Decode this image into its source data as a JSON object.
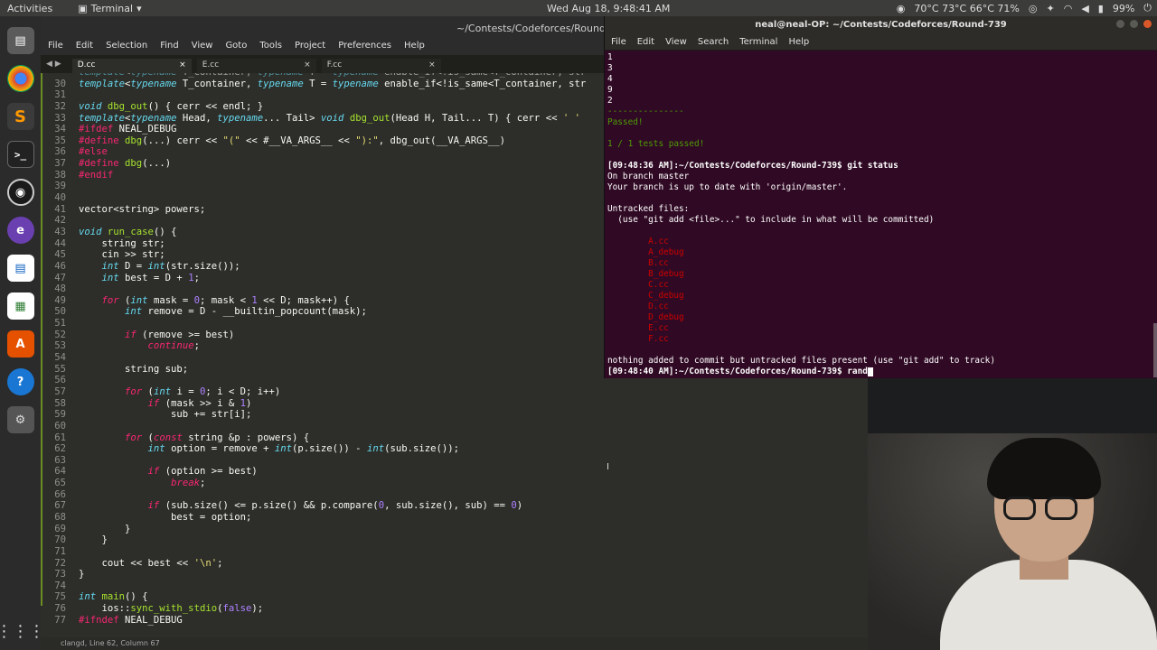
{
  "topbar": {
    "activities": "Activities",
    "app_name": "Terminal",
    "clock": "Wed Aug 18, 9:48:41 AM",
    "sensors": "70°C 73°C 66°C 71%",
    "battery": "99%"
  },
  "dock": {
    "apps": [
      {
        "name": "files",
        "icon": "files-icon"
      },
      {
        "name": "chrome",
        "icon": "chrome-icon"
      },
      {
        "name": "sublime",
        "icon": "sublime-icon"
      },
      {
        "name": "terminal",
        "icon": "terminal-icon"
      },
      {
        "name": "obs",
        "icon": "obs-icon"
      },
      {
        "name": "emacs",
        "icon": "emacs-icon"
      },
      {
        "name": "writer",
        "icon": "writer-icon"
      },
      {
        "name": "calc",
        "icon": "calc-icon"
      },
      {
        "name": "software",
        "icon": "software-icon"
      },
      {
        "name": "help",
        "icon": "help-icon"
      },
      {
        "name": "settings",
        "icon": "settings-icon"
      }
    ]
  },
  "editor": {
    "title": "~/Contests/Codeforces/Round-739",
    "menu": [
      "File",
      "Edit",
      "Selection",
      "Find",
      "View",
      "Goto",
      "Tools",
      "Project",
      "Preferences",
      "Help"
    ],
    "tabs": [
      {
        "label": "D.cc",
        "active": true
      },
      {
        "label": "E.cc",
        "active": false
      },
      {
        "label": "F.cc",
        "active": false
      }
    ],
    "status": "clangd, Line 62, Column 67"
  },
  "terminal": {
    "title": "neal@neal-OP: ~/Contests/Codeforces/Round-739",
    "menu": [
      "File",
      "Edit",
      "View",
      "Search",
      "Terminal",
      "Help"
    ],
    "lines": [
      {
        "text": "1",
        "cls": ""
      },
      {
        "text": "3",
        "cls": ""
      },
      {
        "text": "4",
        "cls": ""
      },
      {
        "text": "9",
        "cls": ""
      },
      {
        "text": "2",
        "cls": ""
      },
      {
        "text": "---------------",
        "cls": "gr"
      },
      {
        "text": "Passed!",
        "cls": "gr"
      },
      {
        "text": "",
        "cls": ""
      },
      {
        "text": "1 / 1 tests passed!",
        "cls": "gr"
      },
      {
        "text": "",
        "cls": ""
      },
      {
        "text": "[09:48:36 AM]:~/Contests/Codeforces/Round-739$ git status",
        "cls": "bd"
      },
      {
        "text": "On branch master",
        "cls": ""
      },
      {
        "text": "Your branch is up to date with 'origin/master'.",
        "cls": ""
      },
      {
        "text": "",
        "cls": ""
      },
      {
        "text": "Untracked files:",
        "cls": ""
      },
      {
        "text": "  (use \"git add <file>...\" to include in what will be committed)",
        "cls": ""
      },
      {
        "text": "",
        "cls": ""
      },
      {
        "text": "        A.cc",
        "cls": "rd"
      },
      {
        "text": "        A_debug",
        "cls": "rd"
      },
      {
        "text": "        B.cc",
        "cls": "rd"
      },
      {
        "text": "        B_debug",
        "cls": "rd"
      },
      {
        "text": "        C.cc",
        "cls": "rd"
      },
      {
        "text": "        C_debug",
        "cls": "rd"
      },
      {
        "text": "        D.cc",
        "cls": "rd"
      },
      {
        "text": "        D_debug",
        "cls": "rd"
      },
      {
        "text": "        E.cc",
        "cls": "rd"
      },
      {
        "text": "        F.cc",
        "cls": "rd"
      },
      {
        "text": "",
        "cls": ""
      },
      {
        "text": "nothing added to commit but untracked files present (use \"git add\" to track)",
        "cls": ""
      },
      {
        "text": "[09:48:40 AM]:~/Contests/Codeforces/Round-739$ rand",
        "cls": "bd"
      }
    ]
  },
  "code_lines": [
    {
      "n": "",
      "h": "<span class=\"t\">template</span>&lt;<span class=\"t\">typename</span> T_container, <span class=\"t\">typename</span> T = <span class=\"t\">typename</span> enable_if&lt;!is_same&lt;T_container, str"
    },
    {
      "n": "30",
      "h": "<span class=\"t\">template</span>&lt;<span class=\"t\">typename</span> T_container, <span class=\"t\">typename</span> T = <span class=\"t\">typename</span> enable_if&lt;!is_same&lt;T_container, str"
    },
    {
      "n": "31",
      "h": ""
    },
    {
      "n": "32",
      "h": "<span class=\"t\">void</span> <span class=\"f\">dbg_out</span>() { cerr &lt;&lt; endl; }"
    },
    {
      "n": "33",
      "h": "<span class=\"t\">template</span>&lt;<span class=\"t\">typename</span> Head, <span class=\"t\">typename</span>... Tail&gt; <span class=\"t\">void</span> <span class=\"f\">dbg_out</span>(Head H, Tail... T) { cerr &lt;&lt; <span class=\"s\">' '</span>"
    },
    {
      "n": "34",
      "h": "<span class=\"p\">#ifdef</span> NEAL_DEBUG"
    },
    {
      "n": "35",
      "h": "<span class=\"p\">#define</span> <span class=\"f\">dbg</span>(...) cerr &lt;&lt; <span class=\"s\">\"(\"</span> &lt;&lt; #__VA_ARGS__ &lt;&lt; <span class=\"s\">\"):\"</span>, dbg_out(__VA_ARGS__)"
    },
    {
      "n": "36",
      "h": "<span class=\"p\">#else</span>"
    },
    {
      "n": "37",
      "h": "<span class=\"p\">#define</span> <span class=\"f\">dbg</span>(...)"
    },
    {
      "n": "38",
      "h": "<span class=\"p\">#endif</span>"
    },
    {
      "n": "39",
      "h": ""
    },
    {
      "n": "40",
      "h": ""
    },
    {
      "n": "41",
      "h": "vector&lt;string&gt; powers;"
    },
    {
      "n": "42",
      "h": ""
    },
    {
      "n": "43",
      "h": "<span class=\"t\">void</span> <span class=\"f\">run_case</span>() {"
    },
    {
      "n": "44",
      "h": "    string str;"
    },
    {
      "n": "45",
      "h": "    cin &gt;&gt; str;"
    },
    {
      "n": "46",
      "h": "    <span class=\"t\">int</span> D = <span class=\"t\">int</span>(str.size());"
    },
    {
      "n": "47",
      "h": "    <span class=\"t\">int</span> best = D + <span class=\"n\">1</span>;"
    },
    {
      "n": "48",
      "h": ""
    },
    {
      "n": "49",
      "h": "    <span class=\"k\">for</span> (<span class=\"t\">int</span> mask = <span class=\"n\">0</span>; mask &lt; <span class=\"n\">1</span> &lt;&lt; D; mask++) {"
    },
    {
      "n": "50",
      "h": "        <span class=\"t\">int</span> remove = D - __builtin_popcount(mask);"
    },
    {
      "n": "51",
      "h": ""
    },
    {
      "n": "52",
      "h": "        <span class=\"k\">if</span> (remove &gt;= best)"
    },
    {
      "n": "53",
      "h": "            <span class=\"k\">continue</span>;"
    },
    {
      "n": "54",
      "h": ""
    },
    {
      "n": "55",
      "h": "        string sub;"
    },
    {
      "n": "56",
      "h": ""
    },
    {
      "n": "57",
      "h": "        <span class=\"k\">for</span> (<span class=\"t\">int</span> i = <span class=\"n\">0</span>; i &lt; D; i++)"
    },
    {
      "n": "58",
      "h": "            <span class=\"k\">if</span> (mask &gt;&gt; i &amp; <span class=\"n\">1</span>)"
    },
    {
      "n": "59",
      "h": "                sub += str[i];"
    },
    {
      "n": "60",
      "h": ""
    },
    {
      "n": "61",
      "h": "        <span class=\"k\">for</span> (<span class=\"k\">const</span> string &amp;p : powers) {"
    },
    {
      "n": "62",
      "h": "            <span class=\"t\">int</span> option = remove + <span class=\"t\">int</span>(p.size()) - <span class=\"t\">int</span>(sub.size());"
    },
    {
      "n": "63",
      "h": ""
    },
    {
      "n": "64",
      "h": "            <span class=\"k\">if</span> (option &gt;= best)"
    },
    {
      "n": "65",
      "h": "                <span class=\"k\">break</span>;"
    },
    {
      "n": "66",
      "h": ""
    },
    {
      "n": "67",
      "h": "            <span class=\"k\">if</span> (sub.size() &lt;= p.size() &amp;&amp; p.compare(<span class=\"n\">0</span>, sub.size(), sub) == <span class=\"n\">0</span>)"
    },
    {
      "n": "68",
      "h": "                best = option;"
    },
    {
      "n": "69",
      "h": "        }"
    },
    {
      "n": "70",
      "h": "    }"
    },
    {
      "n": "71",
      "h": ""
    },
    {
      "n": "72",
      "h": "    cout &lt;&lt; best &lt;&lt; <span class=\"s\">'\\n'</span>;"
    },
    {
      "n": "73",
      "h": "}"
    },
    {
      "n": "74",
      "h": ""
    },
    {
      "n": "75",
      "h": "<span class=\"t\">int</span> <span class=\"f\">main</span>() {"
    },
    {
      "n": "76",
      "h": "    ios::<span class=\"f\">sync_with_stdio</span>(<span class=\"n\">false</span>);"
    },
    {
      "n": "77",
      "h": "<span class=\"p\">#ifndef</span> NEAL_DEBUG"
    }
  ]
}
